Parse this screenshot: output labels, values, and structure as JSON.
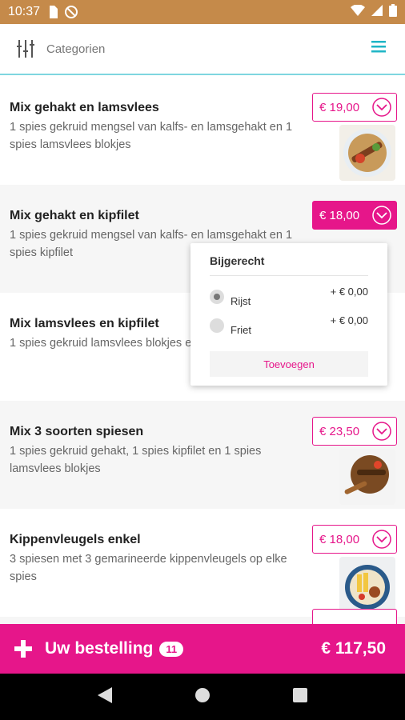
{
  "status_bar": {
    "time": "10:37"
  },
  "header": {
    "title": "Categorien"
  },
  "menu_items": [
    {
      "name": "Mix gehakt en lamsvlees",
      "description": "1 spies gekruid mengsel van kalfs- en lamsgehakt en 1 spies lamsvlees blokjes",
      "price": "€ 19,00"
    },
    {
      "name": "Mix gehakt en kipfilet",
      "description": "1 spies gekruid mengsel van kalfs- en lamsgehakt en 1 spies kipfilet",
      "price": "€ 18,00"
    },
    {
      "name": "Mix lamsvlees en kipfilet",
      "description": "1 spies gekruid lamsvlees blokjes en 1 spies kipfilet",
      "price": ""
    },
    {
      "name": "Mix 3 soorten spiesen",
      "description": "1 spies gekruid gehakt, 1 spies kipfilet en 1 spies lamsvlees blokjes",
      "price": "€ 23,50"
    },
    {
      "name": "Kippenvleugels enkel",
      "description": "3 spiesen met 3 gemarineerde kippenvleugels op elke spies",
      "price": "€ 18,00"
    }
  ],
  "popup": {
    "title": "Bijgerecht",
    "options": [
      {
        "label": "Rijst",
        "extra": "+ € 0,00",
        "selected": true
      },
      {
        "label": "Friet",
        "extra": "+ € 0,00",
        "selected": false
      }
    ],
    "add_label": "Toevoegen"
  },
  "order_bar": {
    "label": "Uw bestelling",
    "count": "11",
    "total": "€ 117,50"
  },
  "colors": {
    "accent": "#e6168a",
    "status_bar": "#c58a4a",
    "divider": "#7fd6e0"
  },
  "icons": [
    "wifi-icon",
    "battery-icon",
    "filter-sliders-icon",
    "hamburger-menu-icon",
    "chevron-down-icon",
    "plus-icon",
    "back-icon",
    "home-icon",
    "recents-icon"
  ]
}
